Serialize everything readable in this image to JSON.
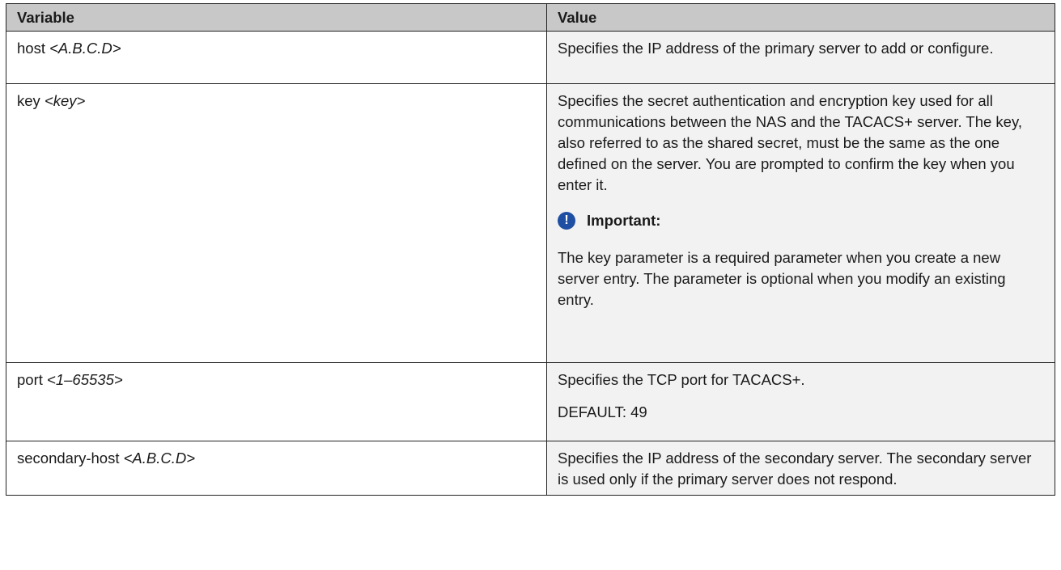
{
  "table": {
    "headers": {
      "variable": "Variable",
      "value": "Value"
    },
    "rows": [
      {
        "variable_cmd": "host ",
        "variable_param": "<A.B.C.D>",
        "value_paragraphs": [
          "Specifies the IP address of the primary server to add or configure."
        ]
      },
      {
        "variable_cmd": "key ",
        "variable_param": "<key>",
        "value_paragraphs": [
          "Specifies the secret authentication and encryption key used for all communications between the NAS and the TACACS+ server. The key, also referred to as the shared secret, must be the same as the one defined on the server. You are prompted to confirm the key when you enter it."
        ],
        "important_label": "Important:",
        "important_icon_glyph": "!",
        "important_icon_color": "#1f4fa3",
        "important_text": "The key parameter is a required parameter when you create a new server entry. The parameter is optional when you modify an existing entry."
      },
      {
        "variable_cmd": "port ",
        "variable_param": "<1–65535>",
        "value_paragraphs": [
          "Specifies the TCP port for TACACS+.",
          "DEFAULT: 49"
        ]
      },
      {
        "variable_cmd": "secondary-host ",
        "variable_param": "<A.B.C.D>",
        "value_paragraphs": [
          "Specifies the IP address of the secondary server. The secondary server is used only if the primary server does not respond."
        ]
      }
    ]
  }
}
